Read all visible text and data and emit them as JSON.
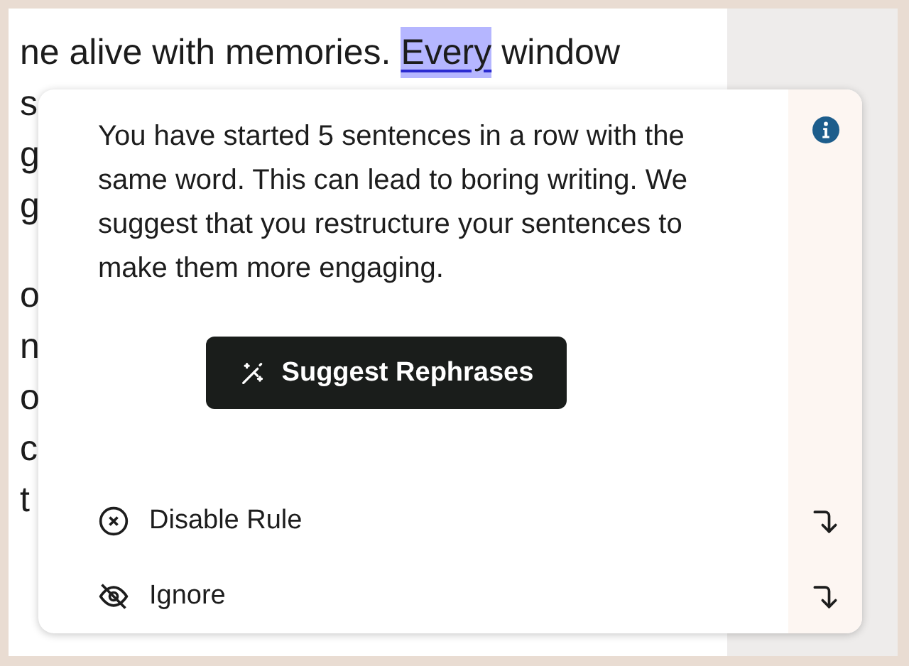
{
  "document": {
    "paragraphs": [
      {
        "lines": [
          {
            "segments": [
              {
                "text": "ne alive with memories.",
                "highlighted": false
              },
              {
                "text": "Every",
                "highlighted": true
              },
              {
                "text": "window",
                "highlighted": false
              }
            ]
          },
          {
            "segments": [
              {
                "text": "s",
                "highlighted": false
              }
            ]
          },
          {
            "segments": [
              {
                "text": "g",
                "highlighted": false
              }
            ]
          },
          {
            "segments": [
              {
                "text": "g",
                "highlighted": false
              }
            ]
          }
        ]
      },
      {
        "lines": [
          {
            "segments": [
              {
                "text": "o",
                "highlighted": false
              }
            ]
          },
          {
            "segments": [
              {
                "text": "n",
                "highlighted": false
              }
            ]
          },
          {
            "segments": [
              {
                "text": "o",
                "highlighted": false
              }
            ]
          },
          {
            "segments": [
              {
                "text": "c",
                "highlighted": false
              }
            ]
          },
          {
            "segments": [
              {
                "text": "t",
                "highlighted": false
              }
            ]
          }
        ]
      }
    ]
  },
  "popup": {
    "message": "You have started 5 sentences in a row with the same word. This can lead to boring writing. We suggest that you restructure your sentences to make them more engaging.",
    "primary_button": "Suggest Rephrases",
    "actions": [
      {
        "kind": "disable",
        "label": "Disable Rule"
      },
      {
        "kind": "ignore",
        "label": "Ignore"
      }
    ]
  }
}
